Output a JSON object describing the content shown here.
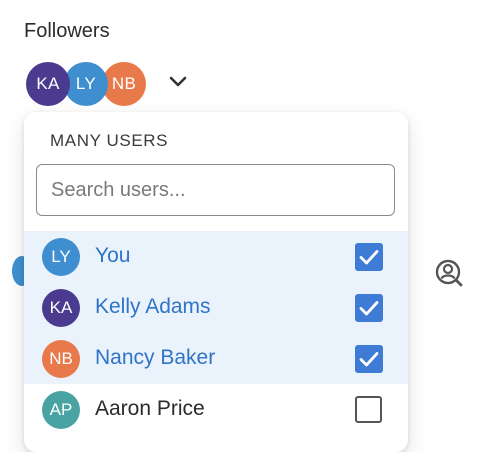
{
  "field_label": "Followers",
  "stack": [
    {
      "initials": "KA",
      "color": "#4b3b8f"
    },
    {
      "initials": "LY",
      "color": "#3f8fd0"
    },
    {
      "initials": "NB",
      "color": "#e8794b"
    }
  ],
  "dropdown_icon": "chevron-down-icon",
  "owner_icon": "user-search-icon",
  "popover": {
    "title": "MANY USERS",
    "search_placeholder": "Search users...",
    "search_value": "",
    "users": [
      {
        "initials": "LY",
        "name": "You",
        "color": "#3f8fd0",
        "selected": true
      },
      {
        "initials": "KA",
        "name": "Kelly Adams",
        "color": "#4b3b8f",
        "selected": true
      },
      {
        "initials": "NB",
        "name": "Nancy Baker",
        "color": "#e8794b",
        "selected": true
      },
      {
        "initials": "AP",
        "name": "Aaron Price",
        "color": "#4aa3a3",
        "selected": false
      }
    ]
  },
  "colors": {
    "accent": "#3d7bd4",
    "selected_row_bg": "#eaf2fc",
    "selected_text": "#2f74c7"
  }
}
